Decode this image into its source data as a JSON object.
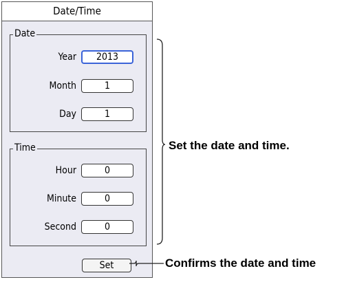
{
  "dialog": {
    "title": "Date/Time",
    "date_group": {
      "label": "Date",
      "fields": [
        {
          "label": "Year",
          "value": "2013"
        },
        {
          "label": "Month",
          "value": "1"
        },
        {
          "label": "Day",
          "value": "1"
        }
      ]
    },
    "time_group": {
      "label": "Time",
      "fields": [
        {
          "label": "Hour",
          "value": "0"
        },
        {
          "label": "Minute",
          "value": "0"
        },
        {
          "label": "Second",
          "value": "0"
        }
      ]
    },
    "set_button": "Set"
  },
  "annotations": {
    "bracket_text": "Set the date and time.",
    "set_text": "Confirms the date and time"
  }
}
